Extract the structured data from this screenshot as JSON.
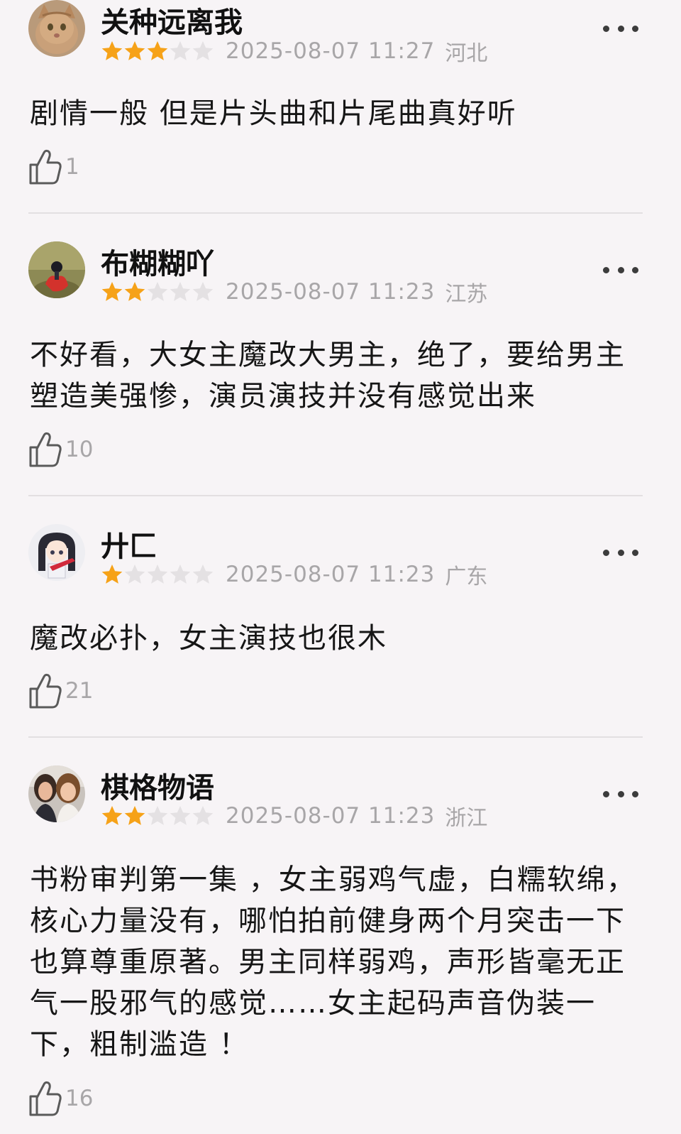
{
  "reviews": [
    {
      "username": "关种远离我",
      "rating": 3,
      "rating_max": 5,
      "timestamp": "2025-08-07 11:27",
      "location": "河北",
      "text": "剧情一般 但是片头曲和片尾曲真好听",
      "likes": "1",
      "avatar": "orange-cat-avatar"
    },
    {
      "username": "布糊糊吖",
      "rating": 2,
      "rating_max": 5,
      "timestamp": "2025-08-07 11:23",
      "location": "江苏",
      "text": "不好看，大女主魔改大男主，绝了，要给男主塑造美强惨，演员演技并没有感觉出来",
      "likes": "10",
      "avatar": "hand-holding-figure-avatar"
    },
    {
      "username": "廾匚",
      "rating": 1,
      "rating_max": 5,
      "timestamp": "2025-08-07 11:23",
      "location": "广东",
      "text": "魔改必扑，女主演技也很木",
      "likes": "21",
      "avatar": "anime-guitar-girl-avatar"
    },
    {
      "username": "棋格物语",
      "rating": 2,
      "rating_max": 5,
      "timestamp": "2025-08-07 11:23",
      "location": "浙江",
      "text": "书粉审判第一集 ，女主弱鸡气虚，白糯软绵，核心力量没有，哪怕拍前健身两个月突击一下也算尊重原著。男主同样弱鸡，声形皆毫无正气一股邪气的感觉……女主起码声音伪装一下，粗制滥造 ！",
      "likes": "16",
      "avatar": "two-women-photo-avatar"
    }
  ],
  "colors": {
    "background": "#f7f4f6",
    "star_filled": "#f6a218",
    "star_empty": "#e4e1e3",
    "meta_text": "#a8a6a8",
    "divider": "#e3dfe1"
  },
  "icons": {
    "more": "ellipsis-icon",
    "like": "thumbs-up-icon",
    "star": "star-icon"
  }
}
